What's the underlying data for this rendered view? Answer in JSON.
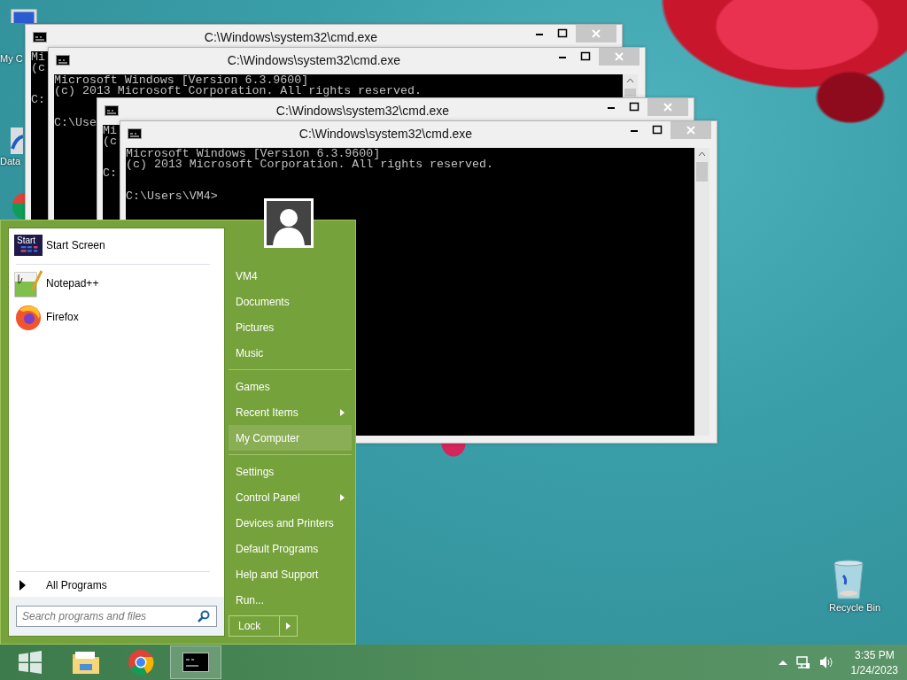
{
  "desktop_icons": [
    {
      "kind": "computer",
      "label": "My C"
    },
    {
      "kind": "drive",
      "label": "Data"
    },
    {
      "kind": "recycle",
      "label": "Recycle Bin"
    }
  ],
  "windows": [
    {
      "title": "C:\\Windows\\system32\\cmd.exe",
      "banner": [
        "Mi",
        "(c"
      ],
      "prompt": "C:"
    },
    {
      "title": "C:\\Windows\\system32\\cmd.exe",
      "banner": [
        "Microsoft Windows [Version 6.3.9600]",
        "(c) 2013 Microsoft Corporation. All rights reserved."
      ],
      "prompt": "C:\\Use"
    },
    {
      "title": "C:\\Windows\\system32\\cmd.exe",
      "banner": [
        "Mi",
        "(c"
      ],
      "prompt": "C:"
    },
    {
      "title": "C:\\Windows\\system32\\cmd.exe",
      "banner": [
        "Microsoft Windows [Version 6.3.9600]",
        "(c) 2013 Microsoft Corporation. All rights reserved."
      ],
      "prompt": "C:\\Users\\VM4>"
    }
  ],
  "start_menu": {
    "programs": [
      {
        "kind": "start-screen",
        "icon_text": "Start",
        "label": "Start Screen"
      },
      {
        "kind": "notepad",
        "label": "Notepad++"
      },
      {
        "kind": "firefox",
        "label": "Firefox"
      }
    ],
    "all_programs": "All Programs",
    "search": {
      "placeholder": "Search programs and files"
    },
    "places": [
      {
        "items": [
          {
            "label": "VM4",
            "submenu": false,
            "selected": false
          },
          {
            "label": "Documents",
            "submenu": false,
            "selected": false
          },
          {
            "label": "Pictures",
            "submenu": false,
            "selected": false
          },
          {
            "label": "Music",
            "submenu": false,
            "selected": false
          }
        ]
      },
      {
        "items": [
          {
            "label": "Games",
            "submenu": false,
            "selected": false
          },
          {
            "label": "Recent Items",
            "submenu": true,
            "selected": false
          },
          {
            "label": "My Computer",
            "submenu": false,
            "selected": true
          }
        ]
      },
      {
        "items": [
          {
            "label": "Settings",
            "submenu": false,
            "selected": false
          },
          {
            "label": "Control Panel",
            "submenu": true,
            "selected": false
          },
          {
            "label": "Devices and Printers",
            "submenu": false,
            "selected": false
          },
          {
            "label": "Default Programs",
            "submenu": false,
            "selected": false
          },
          {
            "label": "Help and Support",
            "submenu": false,
            "selected": false
          },
          {
            "label": "Run...",
            "submenu": false,
            "selected": false
          }
        ]
      }
    ],
    "lock": "Lock"
  },
  "taskbar": {
    "apps": [
      {
        "kind": "explorer",
        "selected": false
      },
      {
        "kind": "chrome",
        "selected": false
      },
      {
        "kind": "cmd",
        "selected": true
      }
    ],
    "clock": {
      "time": "3:35 PM",
      "date": "1/24/2023"
    }
  }
}
